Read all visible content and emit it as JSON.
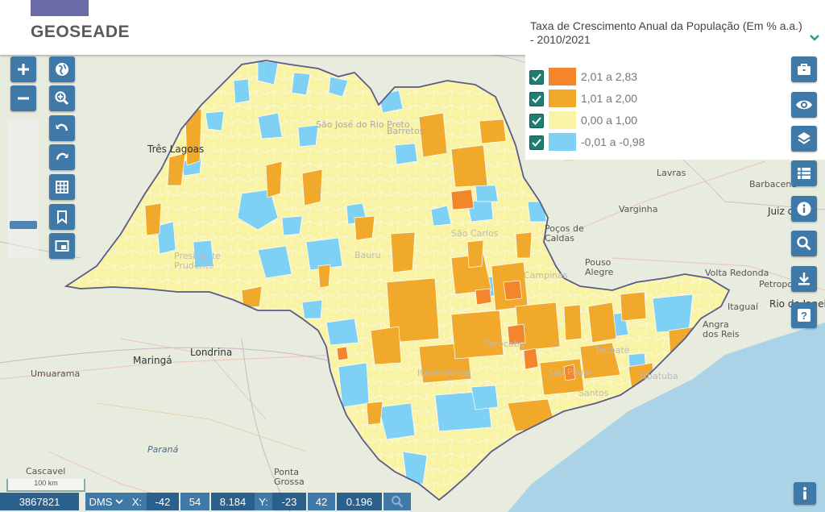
{
  "header": {
    "logo_text": "GEOSEADE"
  },
  "legend": {
    "title": "Taxa de Crescimento Anual da População (Em % a.a.) - 2010/2021",
    "items": [
      {
        "label": "2,01 a 2,83",
        "color": "#f3852b",
        "checked": true
      },
      {
        "label": "1,01 a 2,00",
        "color": "#f0a92a",
        "checked": true
      },
      {
        "label": "0,00 a 1,00",
        "color": "#f9f3a6",
        "checked": true
      },
      {
        "label": "-0,01 a -0,98",
        "color": "#7fd0f5",
        "checked": true
      }
    ]
  },
  "map_labels": {
    "tres_lagoas": "Três Lagoas",
    "sao_jose": "São José do Rio Preto",
    "barretos": "Barretos",
    "lavras": "Lavras",
    "barbacena": "Barbacena",
    "varginha": "Varginha",
    "juiz_de_fora": "Juiz de",
    "pocos_caldas": "Poços de Caldas",
    "pouso_alegre": "Pouso Alegre",
    "volta_redonda": "Volta Redonda",
    "petropolis": "Petropolis",
    "itaguai": "Itaguaí",
    "rio": "Rio de Janeiro",
    "angra": "Angra dos Reis",
    "maringa": "Maringá",
    "londrina": "Londrina",
    "umuarama": "Umuarama",
    "parana": "Paraná",
    "cascavel": "Cascavel",
    "ponta_grossa": "Ponta Grossa",
    "presidente_prudente": "Presidente Prudente",
    "bauru": "Bauru",
    "sao_carlos": "São Carlos",
    "campinas": "Campinas",
    "sorocaba": "Sorocaba",
    "sao_paulo": "São Paulo",
    "santos": "Santos",
    "itapetininga": "Itapetininga",
    "taubate": "Taubaté",
    "ubatuba": "Ubatuba"
  },
  "scale": {
    "label": "100 km"
  },
  "coords": {
    "value": "3867821",
    "format": "DMS",
    "x_label": "X:",
    "x_deg": "-42",
    "x_min": "54",
    "x_sec": "8.184",
    "y_label": "Y:",
    "y_deg": "-23",
    "y_min": "42",
    "y_sec": "0.196"
  },
  "icons": {
    "left_tools": [
      "zoom-in-icon",
      "zoom-out-icon",
      "globe-icon",
      "zoom-box-icon",
      "undo-icon",
      "redo-icon",
      "grid-icon",
      "bookmark-icon",
      "overview-icon"
    ],
    "right_tools": [
      "toolbox-icon",
      "eye-icon",
      "layers-icon",
      "list-icon",
      "info-icon",
      "search-icon",
      "download-icon",
      "help-icon",
      "info-small-icon"
    ],
    "bar_tools": [
      "chevron-down-icon",
      "magnifier-icon"
    ]
  },
  "colors": {
    "button": "#3f79a8",
    "accent": "#1f7e73",
    "state_border": "#5a5a8a"
  }
}
